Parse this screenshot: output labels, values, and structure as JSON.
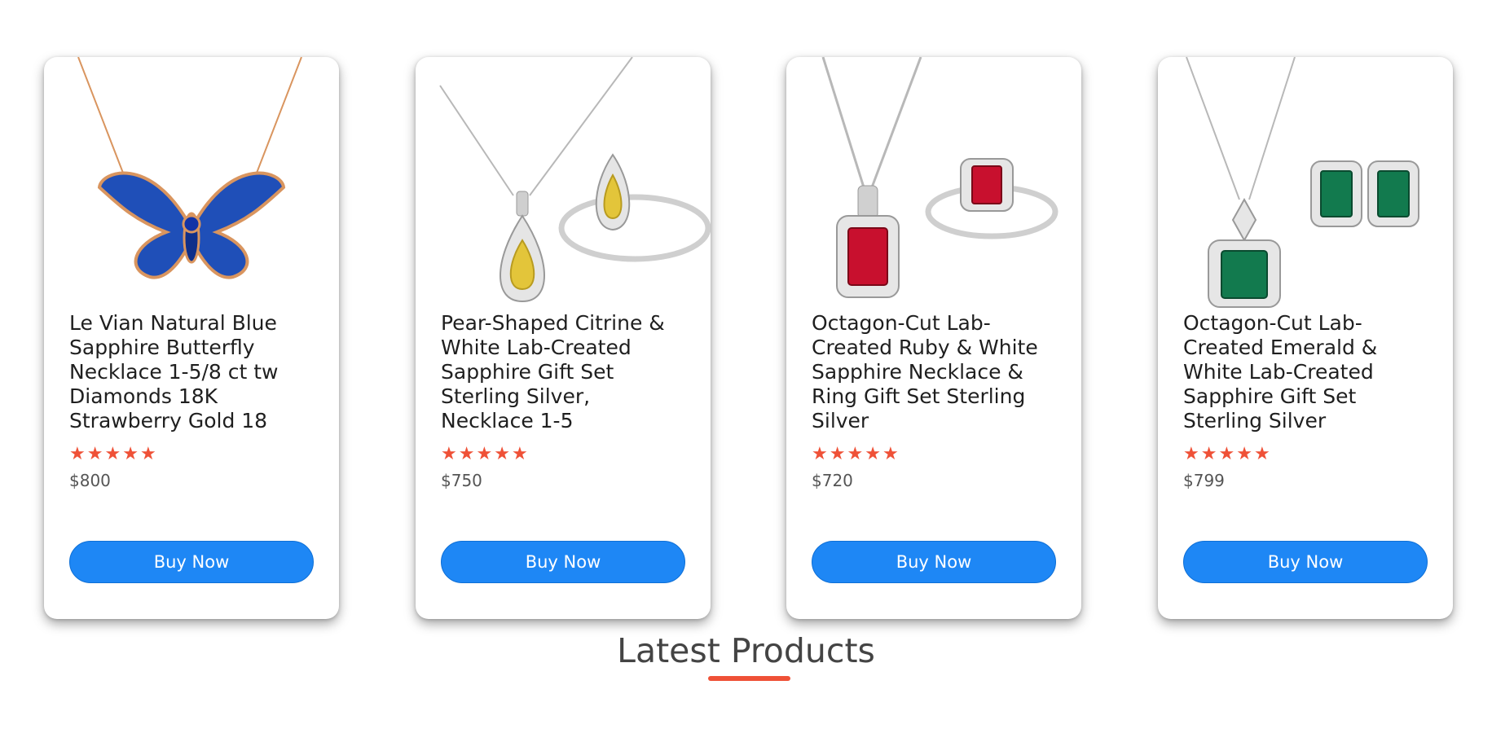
{
  "products": [
    {
      "title": "Le Vian Natural Blue Sapphire Butterfly Necklace 1-5/8 ct tw Diamonds 18K Strawberry Gold 18",
      "rating": 5,
      "price": "$800",
      "button": "Buy Now",
      "image_icon": "butterfly-necklace-icon",
      "colors": {
        "metal": "#d9955f",
        "stone": "#1f4fb8"
      }
    },
    {
      "title": "Pear-Shaped Citrine & White Lab-Created Sapphire Gift Set Sterling Silver, Necklace 1-5",
      "rating": 5,
      "price": "$750",
      "button": "Buy Now",
      "image_icon": "citrine-set-icon",
      "colors": {
        "metal": "#b8b8b8",
        "stone": "#e3c53a"
      }
    },
    {
      "title": "Octagon-Cut Lab-Created Ruby & White Sapphire Necklace & Ring Gift Set Sterling Silver",
      "rating": 5,
      "price": "$720",
      "button": "Buy Now",
      "image_icon": "ruby-set-icon",
      "colors": {
        "metal": "#b8b8b8",
        "stone": "#c8102e"
      }
    },
    {
      "title": "Octagon-Cut Lab-Created Emerald & White Lab-Created Sapphire Gift Set Sterling Silver",
      "rating": 5,
      "price": "$799",
      "button": "Buy Now",
      "image_icon": "emerald-set-icon",
      "colors": {
        "metal": "#b8b8b8",
        "stone": "#127a4e"
      }
    }
  ],
  "section": {
    "title": "Latest Products"
  },
  "theme": {
    "accent": "#ef5137",
    "button": "#1e87f5"
  }
}
